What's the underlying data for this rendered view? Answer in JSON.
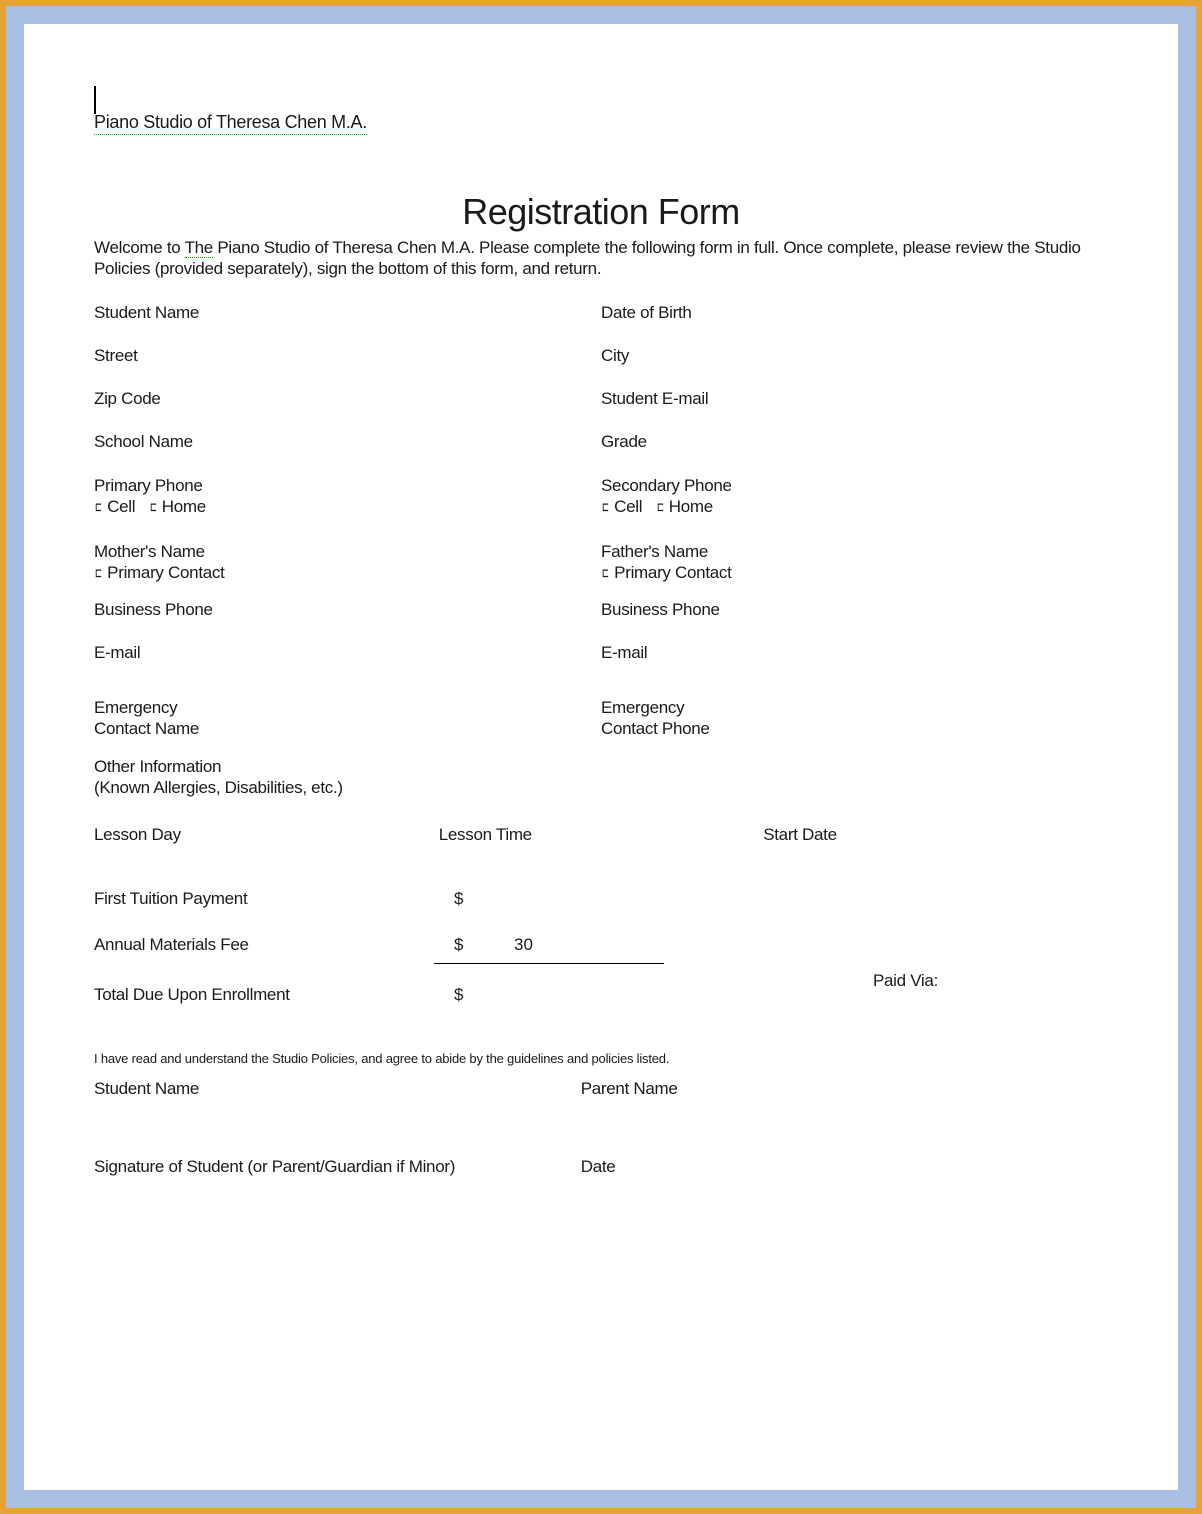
{
  "header": {
    "studio_name": "Piano Studio of Theresa Chen M.A."
  },
  "form": {
    "title": "Registration Form",
    "intro_prefix": "Welcome to ",
    "intro_underline": "The",
    "intro_rest": " Piano Studio of Theresa Chen M.A.   Please complete the following form in full.  Once complete, please review the Studio Policies (provided separately), sign the bottom of this form, and return.",
    "fields": {
      "student_name": "Student Name",
      "dob": "Date of Birth",
      "street": "Street",
      "city": "City",
      "zip": "Zip Code",
      "student_email": "Student E-mail",
      "school_name": "School Name",
      "grade": "Grade",
      "primary_phone": "Primary Phone",
      "secondary_phone": "Secondary Phone",
      "cell": "Cell",
      "home": "Home",
      "mothers_name": "Mother's Name",
      "fathers_name": "Father's Name",
      "primary_contact": "Primary Contact",
      "business_phone_left": "Business Phone",
      "business_phone_right": "Business Phone",
      "email_left": "E-mail",
      "email_right": "E-mail",
      "emergency_contact_name_line1": "Emergency",
      "emergency_contact_name_line2": "Contact Name",
      "emergency_contact_phone_line1": "Emergency",
      "emergency_contact_phone_line2": "Contact Phone",
      "other_info_line1": "Other Information",
      "other_info_line2": "(Known Allergies, Disabilities, etc.)",
      "lesson_day": "Lesson Day",
      "lesson_time": "Lesson Time",
      "start_date": "Start Date"
    },
    "payments": {
      "first_tuition_label": "First Tuition Payment",
      "annual_fee_label": "Annual Materials Fee",
      "annual_fee_value": "30",
      "total_due_label": "Total Due Upon Enrollment",
      "dollar": "$",
      "paid_via": "Paid Via:"
    },
    "agreement": "I have read and understand the Studio Policies, and agree to abide by the guidelines and policies listed.",
    "signature": {
      "student_name": "Student Name",
      "parent_name": "Parent Name",
      "sig_student": "Signature of Student (or Parent/Guardian if Minor)",
      "date": "Date"
    }
  }
}
